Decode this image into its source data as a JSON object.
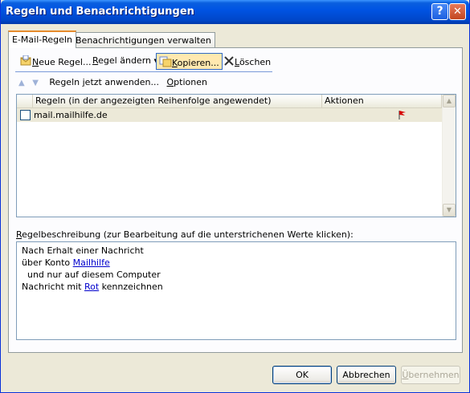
{
  "window": {
    "title": "Regeln und Benachrichtigungen",
    "help_glyph": "?",
    "close_glyph": "✕"
  },
  "tabs": [
    {
      "label": "E-Mail-Regeln",
      "active": true
    },
    {
      "label": "Benachrichtigungen verwalten",
      "active": false
    }
  ],
  "toolbar": {
    "new_rule": {
      "pre": "",
      "u": "N",
      "post": "eue Regel..."
    },
    "edit_rule": {
      "pre": "",
      "u": "R",
      "post": "egel ändern"
    },
    "copy": {
      "pre": "",
      "u": "K",
      "post": "opieren..."
    },
    "delete": {
      "pre": "",
      "u": "L",
      "post": "öschen"
    }
  },
  "row2": {
    "apply": {
      "pre": "Regeln ",
      "u": "j",
      "post": "etzt anwenden..."
    },
    "options": {
      "pre": "",
      "u": "O",
      "post": "ptionen"
    }
  },
  "rules_table": {
    "columns": [
      "Regeln (in der angezeigten Reihenfolge angewendet)",
      "Aktionen"
    ],
    "rows": [
      {
        "name": "mail.mailhilfe.de",
        "checked": false,
        "action_icon": "red-flag-icon"
      }
    ]
  },
  "description": {
    "label_pre": "",
    "label_u": "R",
    "label_post": "egelbeschreibung (zur Bearbeitung auf die unterstrichenen Werte klicken):",
    "line1": "Nach Erhalt einer Nachricht",
    "line2_pre": "über Konto ",
    "line2_link": "Mailhilfe",
    "line3": "  und nur auf diesem Computer",
    "line4_pre": "Nachricht mit ",
    "line4_link": "Rot",
    "line4_post": " kennzeichnen"
  },
  "buttons": {
    "ok": "OK",
    "cancel": "Abbrechen",
    "apply": {
      "pre": "",
      "u": "Ü",
      "post": "bernehmen"
    }
  },
  "colors": {
    "titlebar": "#0054e3",
    "tab_accent": "#e68b2c",
    "link": "#0000cc",
    "flag": "#d40000"
  }
}
